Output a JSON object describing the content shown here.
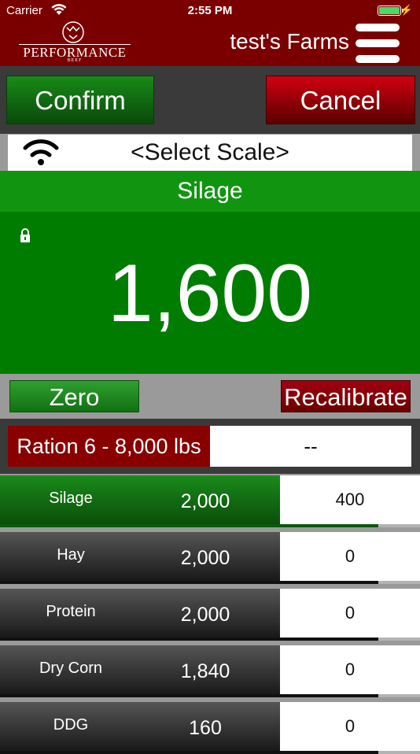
{
  "status": {
    "carrier": "Carrier",
    "time": "2:55 PM"
  },
  "header": {
    "logo_text": "PERFORMANCE",
    "logo_sub": "BEEF",
    "farm_name": "test's Farms"
  },
  "actions": {
    "confirm": "Confirm",
    "cancel": "Cancel"
  },
  "scale": {
    "select_label": "<Select Scale>"
  },
  "display": {
    "ingredient": "Silage",
    "weight": "1,600"
  },
  "controls": {
    "zero": "Zero",
    "recalibrate": "Recalibrate"
  },
  "ration": {
    "label": "Ration 6 - 8,000 lbs",
    "value": "--"
  },
  "ingredients": [
    {
      "name": "Silage",
      "target": "2,000",
      "actual": "400",
      "progress": 0.9,
      "active": true
    },
    {
      "name": "Hay",
      "target": "2,000",
      "actual": "0",
      "progress": 0.9,
      "active": false
    },
    {
      "name": "Protein",
      "target": "2,000",
      "actual": "0",
      "progress": 0.9,
      "active": false
    },
    {
      "name": "Dry Corn",
      "target": "1,840",
      "actual": "0",
      "progress": 0.9,
      "active": false
    },
    {
      "name": "DDG",
      "target": "160",
      "actual": "0",
      "progress": 0.9,
      "active": false
    }
  ],
  "colors": {
    "header": "#7a0000",
    "green": "#007d00",
    "red": "#880000"
  }
}
